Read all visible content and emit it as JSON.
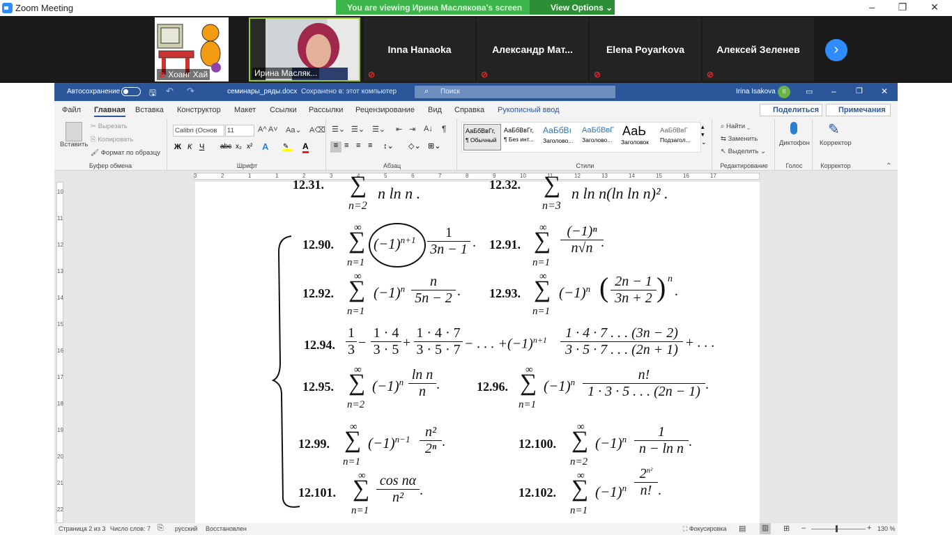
{
  "zoom": {
    "title": "Zoom Meeting",
    "banner": "You are viewing Ирина Маслякова's screen",
    "view_options": "View Options ⌄",
    "participants": [
      {
        "name": "Хоанг Хай"
      },
      {
        "name": "Ирина Масляк..."
      },
      {
        "name": "Inna Hanaoka"
      },
      {
        "name": "Александр  Мат..."
      },
      {
        "name": "Elena Poyarkova"
      },
      {
        "name": "Алексей Зеленев"
      }
    ]
  },
  "word": {
    "autosave": "Автосохранение",
    "filename": "семинары_ряды.docx",
    "saved": "Сохранено в: этот компьютер",
    "search": "Поиск",
    "user": "Irina Isakova",
    "user_initials": "II",
    "tabs": [
      "Файл",
      "Главная",
      "Вставка",
      "Конструктор",
      "Макет",
      "Ссылки",
      "Рассылки",
      "Рецензирование",
      "Вид",
      "Справка",
      "Рукописный ввод"
    ],
    "share": "Поделиться",
    "comments": "Примечания",
    "clipboard": {
      "paste": "Вставить",
      "cut": "Вырезать",
      "copy": "Копировать",
      "format": "Формат по образцу",
      "label": "Буфер обмена"
    },
    "font": {
      "name": "Calibri (Основ",
      "size": "11",
      "label": "Шрифт"
    },
    "paragraph_label": "Абзац",
    "styles": {
      "label": "Стили",
      "items": [
        {
          "sample": "АаБбВвГг,",
          "name": "¶ Обычный"
        },
        {
          "sample": "АаБбВвГг,",
          "name": "¶ Без инт..."
        },
        {
          "sample": "АаБбВı",
          "name": "Заголово..."
        },
        {
          "sample": "АаБбВвГ",
          "name": "Заголово..."
        },
        {
          "sample": "АаЬ",
          "name": "Заголовок"
        },
        {
          "sample": "АаБбВвГ",
          "name": "Подзагол..."
        }
      ]
    },
    "editing": {
      "find": "Найти",
      "replace": "Заменить",
      "select": "Выделить",
      "label": "Редактирование"
    },
    "voice": {
      "btn": "Диктофон",
      "label": "Голос"
    },
    "editor": {
      "btn": "Корректор",
      "label": "Корректор"
    },
    "ruler_ticks": [
      "3",
      "2",
      "1",
      "1",
      "2",
      "3",
      "4",
      "5",
      "6",
      "7",
      "8",
      "9",
      "10",
      "11",
      "12",
      "13",
      "14",
      "15",
      "16",
      "17"
    ],
    "vruler_ticks": [
      "10",
      "11",
      "12",
      "13",
      "14",
      "15",
      "16",
      "17",
      "18",
      "19",
      "20",
      "21",
      "22"
    ],
    "status": {
      "page": "Страница 2 из 3",
      "words": "Число слов: 7",
      "lang": "русский",
      "recovered": "Восстановлен",
      "focus": "Фокусировка",
      "zoom": "130 %"
    }
  },
  "doc": {
    "p31": "12.31.",
    "p32": "12.32.",
    "p90": "12.90.",
    "p91": "12.91.",
    "p92": "12.92.",
    "p93": "12.93.",
    "p94": "12.94.",
    "p95": "12.95.",
    "p96": "12.96.",
    "p99": "12.99.",
    "p100": "12.100.",
    "p101": "12.101.",
    "p102": "12.102."
  }
}
